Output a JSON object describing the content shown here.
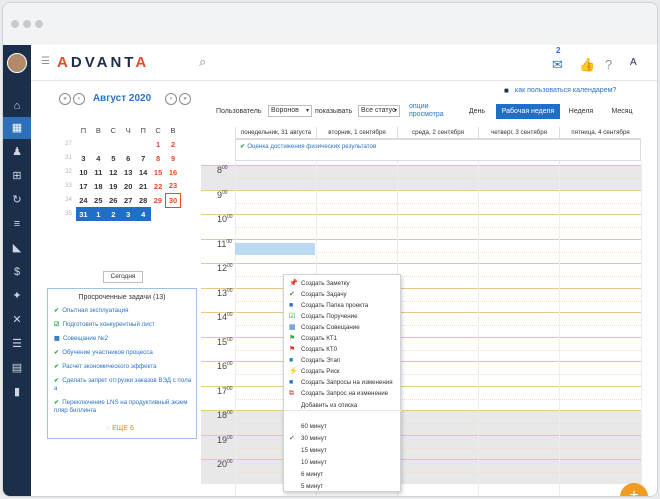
{
  "app": {
    "logo_text": "ADVANTA"
  },
  "topbar": {
    "mail_count": "2",
    "help_icon": "?",
    "profile_letter": "A"
  },
  "calendar_help": "как пользоваться календарем?",
  "mini_calendar": {
    "month": "Август 2020",
    "weekday_headers": [
      "П",
      "В",
      "С",
      "Ч",
      "П",
      "С",
      "В"
    ],
    "weeks": [
      {
        "num": "27",
        "days": [
          "",
          "",
          "",
          "",
          "",
          "1",
          "2"
        ]
      },
      {
        "num": "31",
        "days": [
          "3",
          "4",
          "5",
          "6",
          "7",
          "8",
          "9"
        ]
      },
      {
        "num": "32",
        "days": [
          "10",
          "11",
          "12",
          "13",
          "14",
          "15",
          "16"
        ]
      },
      {
        "num": "33",
        "days": [
          "17",
          "18",
          "19",
          "20",
          "21",
          "22",
          "23"
        ]
      },
      {
        "num": "34",
        "days": [
          "24",
          "25",
          "26",
          "27",
          "28",
          "29",
          "30"
        ]
      },
      {
        "num": "35",
        "days": [
          "31",
          "1",
          "2",
          "3",
          "4",
          "",
          ""
        ]
      }
    ],
    "today_button": "Сегодня"
  },
  "overdue": {
    "title": "Просроченные задачи (13)",
    "items": [
      "Опытная эксплуатация",
      "Подготовить конкурентный лист",
      "Совещание №2",
      "Обучение участников процесса",
      "Расчет экономического эффекта",
      "Сделать запрет отгрузки заказов ВЭД с пола",
      "а",
      "Переключение LNS на продуктивный экзем",
      "пляр биллинга"
    ],
    "more": "ЕЩЕ 6"
  },
  "toolbar": {
    "user_label": "Пользователь",
    "user_value": "Воронов",
    "show_label": "показывать",
    "status_value": "Все статус",
    "view_options_1": "опции",
    "view_options_2": "просмотра",
    "views": [
      "День",
      "Рабочая неделя",
      "Неделя",
      "Месяц"
    ],
    "active_view": "Рабочая неделя"
  },
  "week": {
    "days": [
      "понедельник, 31 августа",
      "вторник, 1 сентября",
      "среда, 2 сентября",
      "четверг, 3 сентября",
      "пятница, 4 сентября"
    ],
    "allday_event": "Оценка достижения физических результатов",
    "hours": [
      "8",
      "9",
      "10",
      "11",
      "12",
      "13",
      "14",
      "15",
      "16",
      "17",
      "18",
      "19",
      "20"
    ],
    "minute_label": "00"
  },
  "context_menu": {
    "items": [
      {
        "label": "Создать Заметку",
        "icon": "pin-icon",
        "color": "#d9332b"
      },
      {
        "label": "Создать Задачу",
        "icon": "check-icon",
        "color": "#2aa83f"
      },
      {
        "label": "Создать Папка проекта",
        "icon": "folder-icon",
        "color": "#2a73c5"
      },
      {
        "label": "Создать Поручение",
        "icon": "assignment-icon",
        "color": "#2aa83f"
      },
      {
        "label": "Создать Совещание",
        "icon": "calendar-icon",
        "color": "#2a73c5"
      },
      {
        "label": "Создать КТ1",
        "icon": "flag-green-icon",
        "color": "#2aa83f"
      },
      {
        "label": "Создать КТ0",
        "icon": "flag-red-icon",
        "color": "#d9332b"
      },
      {
        "label": "Создать Этап",
        "icon": "stage-folder-icon",
        "color": "#1a8fbf"
      },
      {
        "label": "Создать Риск",
        "icon": "risk-icon",
        "color": "#d9332b"
      },
      {
        "label": "Создать Запросы на изменения",
        "icon": "folder-icon",
        "color": "#2a73c5"
      },
      {
        "label": "Создать Запрос на изменение",
        "icon": "change-request-icon",
        "color": "#d9332b"
      },
      {
        "label": "Добавить из списка",
        "icon": "",
        "color": ""
      }
    ],
    "durations": [
      "60 минут",
      "30 минут",
      "15 минут",
      "10 минут",
      "6 минут",
      "5 минут"
    ],
    "checked_duration": "30 минут"
  }
}
